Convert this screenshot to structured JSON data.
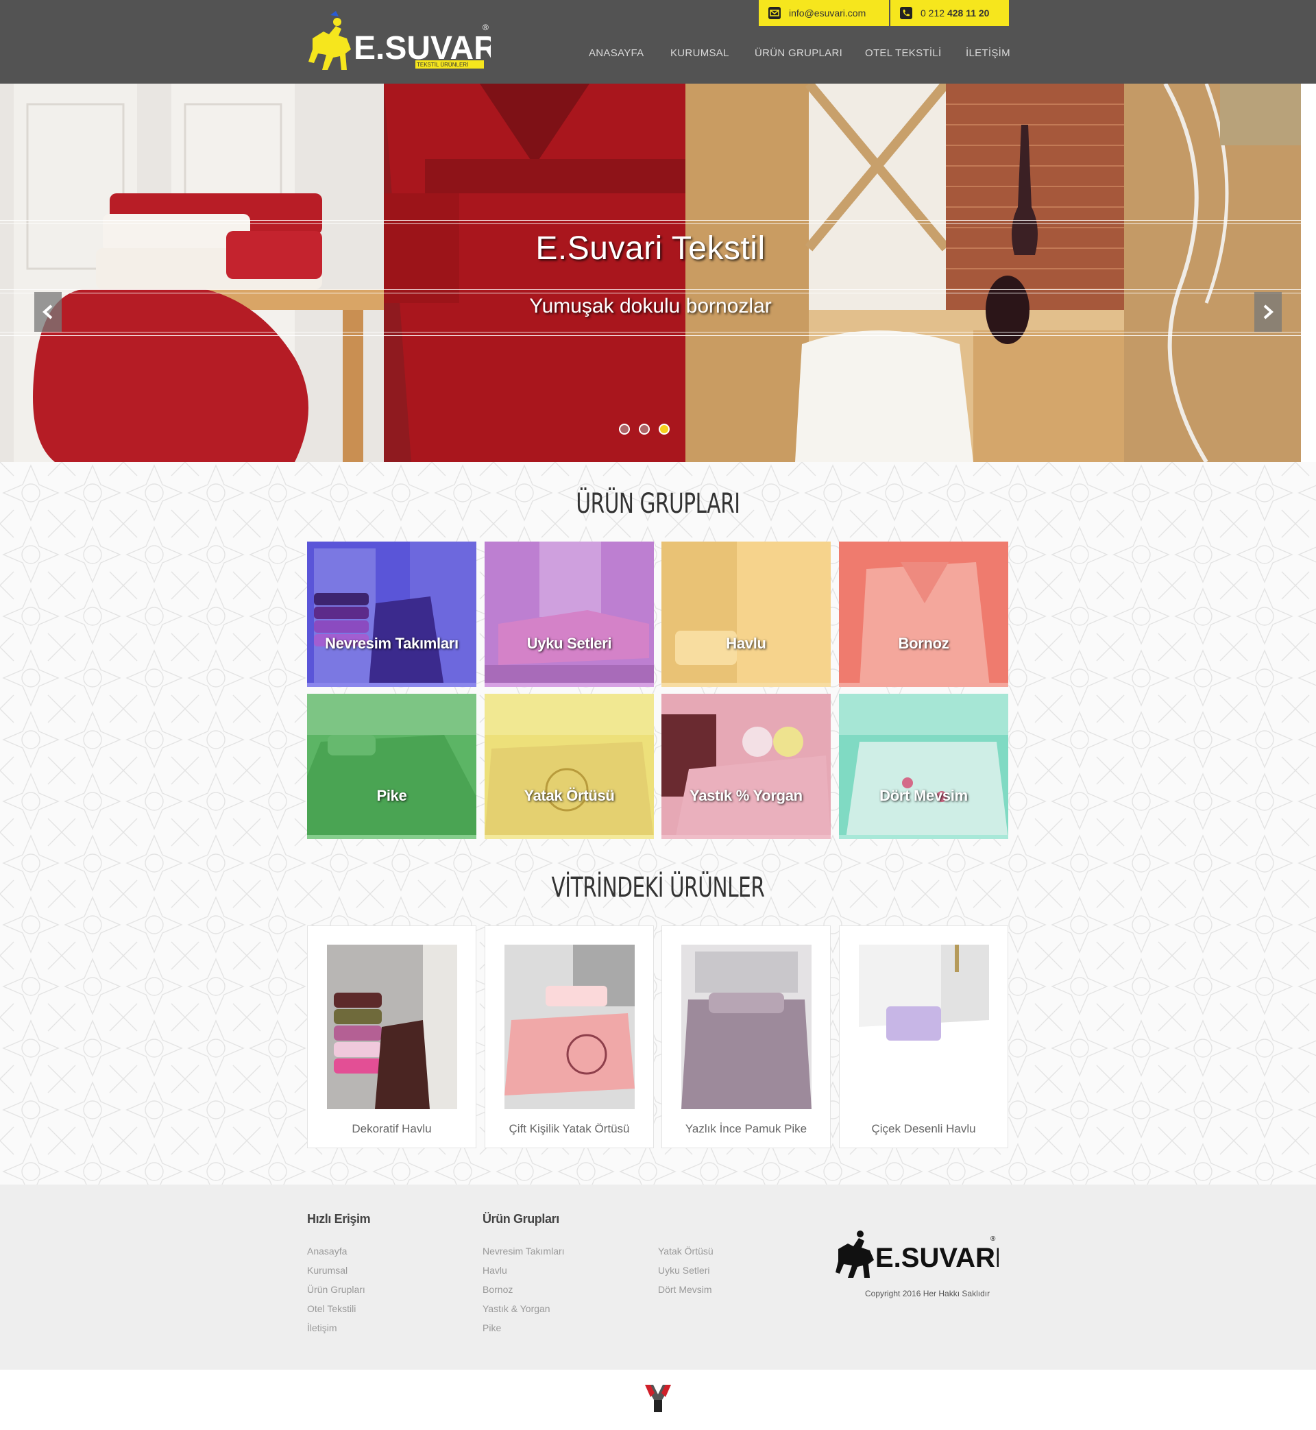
{
  "brand": {
    "name": "E.SUVARI",
    "tagline": "TEKSTİL ÜRÜNLERİ",
    "registered": "®"
  },
  "contact": {
    "email": "info@esuvari.com",
    "phone_prefix": "0 212",
    "phone_number": "428 11 20"
  },
  "nav": [
    "ANASAYFA",
    "KURUMSAL",
    "ÜRÜN GRUPLARI",
    "OTEL TEKSTİLİ",
    "İLETİŞİM"
  ],
  "slider": {
    "title": "E.Suvari Tekstil",
    "subtitle": "Yumuşak dokulu bornozlar",
    "slide_count": 3,
    "active_slide": 3
  },
  "product_groups": {
    "title": "ÜRÜN GRUPLARI",
    "items": [
      {
        "label": "Nevresim Takımları",
        "color": "#4f48d6"
      },
      {
        "label": "Uyku Setleri",
        "color": "#b168c9"
      },
      {
        "label": "Havlu",
        "color": "#f0c46a"
      },
      {
        "label": "Bornoz",
        "color": "#ee7768"
      },
      {
        "label": "Pike",
        "color": "#4caa55"
      },
      {
        "label": "Yatak Örtüsü",
        "color": "#ecdf6a"
      },
      {
        "label": "Yastık % Yorgan",
        "color": "#e0a0b0"
      },
      {
        "label": "Dört Mevsim",
        "color": "#72d6bd"
      }
    ]
  },
  "showcase": {
    "title": "VİTRİNDEKİ ÜRÜNLER",
    "items": [
      {
        "label": "Dekoratif Havlu"
      },
      {
        "label": "Çift Kişilik Yatak Örtüsü"
      },
      {
        "label": "Yazlık İnce Pamuk Pike"
      },
      {
        "label": "Çiçek Desenli Havlu"
      }
    ]
  },
  "footer": {
    "quick_access": {
      "heading": "Hızlı Erişim",
      "links": [
        "Anasayfa",
        "Kurumsal",
        "Ürün Grupları",
        "Otel Tekstili",
        "İletişim"
      ]
    },
    "product_groups": {
      "heading": "Ürün Grupları",
      "col1": [
        "Nevresim Takımları",
        "Havlu",
        "Bornoz",
        "Yastık & Yorgan",
        "Pike"
      ],
      "col2": [
        "Yatak Örtüsü",
        "Uyku Setleri",
        "Dört Mevsim"
      ]
    },
    "copyright": "Copyright 2016 Her Hakkı Saklıdır"
  },
  "colors": {
    "header": "#535353",
    "accent": "#f6e61d",
    "footer": "#eeeeee"
  },
  "icons": {
    "email": "envelope-icon",
    "phone": "phone-icon",
    "prev": "chevron-left-icon",
    "next": "chevron-right-icon"
  }
}
